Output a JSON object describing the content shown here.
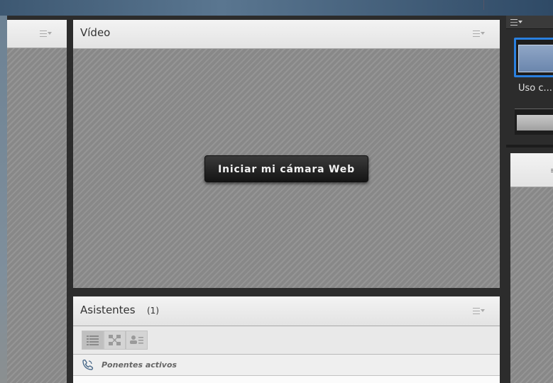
{
  "left_pod": {
    "menu_icon": "pod-menu-icon"
  },
  "video_pod": {
    "title": "Vídeo",
    "menu_icon": "pod-menu-icon",
    "start_webcam_label": "Iniciar mi cámara Web"
  },
  "attendees_pod": {
    "title": "Asistentes",
    "count": "(1)",
    "menu_icon": "pod-menu-icon",
    "view_buttons": [
      "list-view-icon",
      "breakout-view-icon",
      "attendee-status-view-icon"
    ],
    "section_label": "Ponentes activos",
    "section_icon": "phone-speaking-icon"
  },
  "right_panel": {
    "layout_caption": "Uso c..."
  },
  "colors": {
    "accent_blue": "#2a80e0",
    "pod_header": "#ececec",
    "stage_hatch": "#8d8d8d",
    "frame_dark": "#2c2c2c"
  }
}
